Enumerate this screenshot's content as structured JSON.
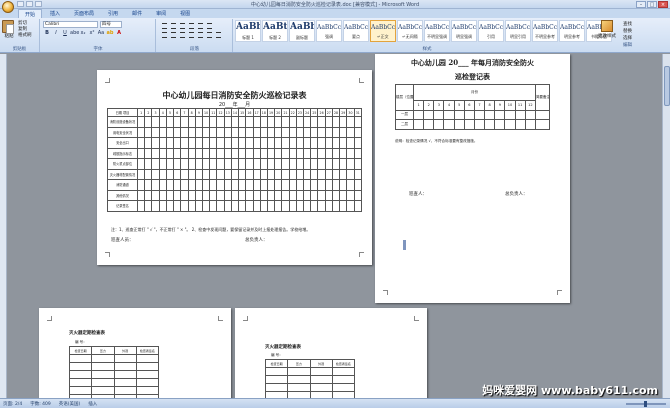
{
  "window": {
    "title": "中心幼儿园每日消防安全防火巡检记录表.doc [兼容模式] - Microsoft Word"
  },
  "tabs": [
    "开始",
    "插入",
    "页面布局",
    "引用",
    "邮件",
    "审阅",
    "视图"
  ],
  "ribbon": {
    "clipboard": {
      "paste": "粘贴",
      "cut": "剪切",
      "copy": "复制",
      "format_painter": "格式刷",
      "label": "剪贴板"
    },
    "font": {
      "name": "Calibri",
      "size": "四号",
      "label": "字体"
    },
    "paragraph": {
      "label": "段落"
    },
    "styles": {
      "items": [
        {
          "sample": "AaBb(",
          "name": "标题 1"
        },
        {
          "sample": "AaBt",
          "name": "标题 2"
        },
        {
          "sample": "AaBbC",
          "name": "副标题"
        },
        {
          "sample": "AaBbCcD",
          "name": "强调"
        },
        {
          "sample": "AaBbCcD",
          "name": "要点"
        },
        {
          "sample": "AaBbCcD",
          "name": "↵正文"
        },
        {
          "sample": "AaBbCcD",
          "name": "↵无间隔"
        },
        {
          "sample": "AaBbCcD",
          "name": "不明显强调"
        },
        {
          "sample": "AaBbCcD",
          "name": "明显强调"
        },
        {
          "sample": "AaBbCcD",
          "name": "引用"
        },
        {
          "sample": "AaBbCcD",
          "name": "明显引用"
        },
        {
          "sample": "AaBbCcD",
          "name": "不明显参考"
        },
        {
          "sample": "AaBbCcD",
          "name": "明显参考"
        },
        {
          "sample": "AaBbCcI",
          "name": "书籍标题"
        }
      ],
      "change": "更改样式",
      "label": "样式"
    },
    "editing": {
      "find": "查找",
      "replace": "替换",
      "select": "选择",
      "label": "编辑"
    }
  },
  "page1": {
    "title": "中心幼儿园每日消防安全防火巡检记录表",
    "date_line": "20___年___月",
    "header_left": "日期 项目",
    "days": [
      "1",
      "2",
      "3",
      "4",
      "5",
      "6",
      "7",
      "8",
      "9",
      "10",
      "11",
      "12",
      "13",
      "14",
      "15",
      "16",
      "17",
      "18",
      "19",
      "20",
      "21",
      "22",
      "23",
      "24",
      "25",
      "26",
      "27",
      "28",
      "29",
      "30",
      "31"
    ],
    "rows": [
      "消防设施设备状况",
      "用电安全状况",
      "安全出口",
      "疏散指示标志",
      "防火重点部位",
      "灭火器材配置情况",
      "消防通道",
      "其他情况",
      "记录签名"
    ],
    "note": "注：1、巡查正常打 \" √ \"，不正常打 \" × \"。          2、检查中发现问题，要保留记录并及时上报处理报告。学校给增。",
    "inspector": "巡查人员：",
    "supervisor": "总负责人："
  },
  "page2": {
    "title": "中心幼儿园 20___ 年每月消防安全防火",
    "title2": "巡检登记表",
    "col_location": "楼层（位置）",
    "col_month": "月份",
    "col_remark": "简要备注",
    "months": [
      "1",
      "2",
      "3",
      "4",
      "5",
      "6",
      "7",
      "8",
      "9",
      "10",
      "11",
      "12"
    ],
    "floors": [
      "一层",
      "二层"
    ],
    "note": "说明：检查记录情况 √，不符合标准要有整改措施。",
    "inspector": "巡查人：",
    "supervisor": "总负责人："
  },
  "page3": {
    "title": "灭火器定期检查表",
    "sub": "编 号：",
    "headers": [
      "检查日期",
      "压力",
      "外观",
      "检查者签名"
    ]
  },
  "page4": {
    "title": "灭火器定期检查表",
    "sub": "编 号：",
    "headers": [
      "检查日期",
      "压力",
      "外观",
      "检查者签名"
    ]
  },
  "watermark": "妈咪爱婴网 www.baby611.com",
  "status": {
    "page": "页面: 2/4",
    "words": "字数: 409",
    "lang": "英语(美国)",
    "mode": "插入"
  }
}
